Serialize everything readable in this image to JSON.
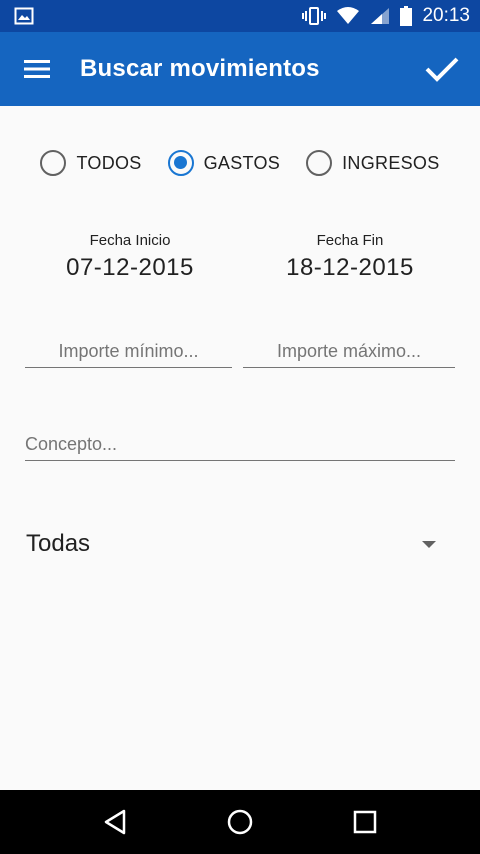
{
  "status_bar": {
    "time": "20:13",
    "icons": [
      "image-icon",
      "vibrate-icon",
      "wifi-icon",
      "signal-icon",
      "battery-icon"
    ]
  },
  "app_bar": {
    "title": "Buscar movimientos",
    "menu_icon": "hamburger-menu-icon",
    "confirm_icon": "check-icon",
    "color": "#1565c0",
    "status_color": "#0d47a1"
  },
  "filter_type": {
    "options": [
      {
        "label": "TODOS",
        "checked": false
      },
      {
        "label": "GASTOS",
        "checked": true
      },
      {
        "label": "INGRESOS",
        "checked": false
      }
    ],
    "accent_color": "#1976d2"
  },
  "dates": {
    "start_label": "Fecha Inicio",
    "start_value": "07-12-2015",
    "end_label": "Fecha Fin",
    "end_value": "18-12-2015"
  },
  "amounts": {
    "min_placeholder": "Importe mínimo...",
    "max_placeholder": "Importe máximo..."
  },
  "concept": {
    "placeholder": "Concepto..."
  },
  "category": {
    "selected": "Todas"
  },
  "nav_bar": {
    "icons": [
      "back-icon",
      "home-icon",
      "recents-icon"
    ]
  }
}
